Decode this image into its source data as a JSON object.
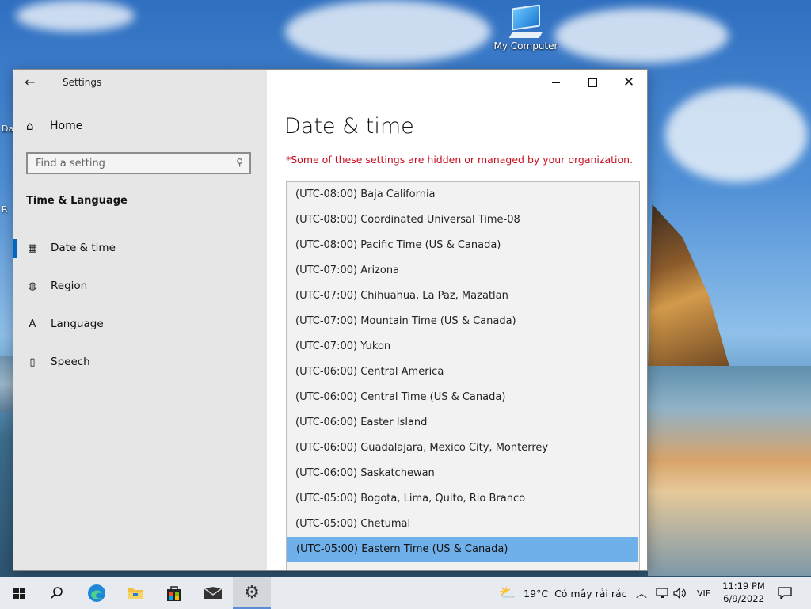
{
  "desktop": {
    "icons": [
      {
        "label": "My Computer",
        "icon": "computer-icon"
      }
    ],
    "edge_labels": [
      "Da",
      "R"
    ]
  },
  "window": {
    "app_title": "Settings",
    "controls": {
      "minimize": "minimize-icon",
      "maximize": "maximize-icon",
      "close": "close-icon"
    },
    "nav": {
      "home_label": "Home",
      "search_placeholder": "Find a setting",
      "section_title": "Time & Language",
      "items": [
        {
          "label": "Date & time",
          "icon": "clock-calendar-icon",
          "selected": true
        },
        {
          "label": "Region",
          "icon": "globe-icon",
          "selected": false
        },
        {
          "label": "Language",
          "icon": "language-icon",
          "selected": false
        },
        {
          "label": "Speech",
          "icon": "microphone-icon",
          "selected": false
        }
      ]
    },
    "content": {
      "title": "Date & time",
      "notice": "*Some of these settings are hidden or managed by your organization.",
      "timezone_options": [
        "(UTC-08:00) Baja California",
        "(UTC-08:00) Coordinated Universal Time-08",
        "(UTC-08:00) Pacific Time (US & Canada)",
        "(UTC-07:00) Arizona",
        "(UTC-07:00) Chihuahua, La Paz, Mazatlan",
        "(UTC-07:00) Mountain Time (US & Canada)",
        "(UTC-07:00) Yukon",
        "(UTC-06:00) Central America",
        "(UTC-06:00) Central Time (US & Canada)",
        "(UTC-06:00) Easter Island",
        "(UTC-06:00) Guadalajara, Mexico City, Monterrey",
        "(UTC-06:00) Saskatchewan",
        "(UTC-05:00) Bogota, Lima, Quito, Rio Branco",
        "(UTC-05:00) Chetumal",
        "(UTC-05:00) Eastern Time (US & Canada)"
      ],
      "selected_timezone": "(UTC-05:00) Eastern Time (US & Canada)"
    }
  },
  "taskbar": {
    "apps": [
      {
        "name": "start",
        "icon": "windows-logo-icon"
      },
      {
        "name": "search",
        "icon": "search-icon"
      },
      {
        "name": "edge",
        "icon": "edge-browser-icon"
      },
      {
        "name": "file-explorer",
        "icon": "folder-icon"
      },
      {
        "name": "store",
        "icon": "store-bag-icon"
      },
      {
        "name": "mail",
        "icon": "mail-icon"
      },
      {
        "name": "settings",
        "icon": "gear-icon",
        "active": true
      }
    ],
    "weather": {
      "temperature": "19°C",
      "condition": "Có mây rải rác",
      "icon": "partly-cloudy-icon"
    },
    "tray": {
      "chevron": "chevron-up-icon",
      "network": "network-icon",
      "volume": "volume-icon",
      "language": "VIE"
    },
    "clock": {
      "time": "11:19 PM",
      "date": "6/9/2022"
    },
    "notifications_icon": "notification-icon"
  }
}
